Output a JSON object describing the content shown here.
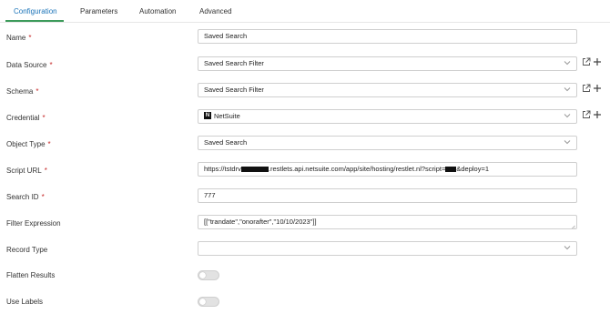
{
  "tabs": [
    {
      "label": "Configuration",
      "active": true
    },
    {
      "label": "Parameters",
      "active": false
    },
    {
      "label": "Automation",
      "active": false
    },
    {
      "label": "Advanced",
      "active": false
    }
  ],
  "required_marker": "*",
  "fields": {
    "name": {
      "label": "Name",
      "value": "Saved Search"
    },
    "data_source": {
      "label": "Data Source",
      "value": "Saved Search Filter"
    },
    "schema": {
      "label": "Schema",
      "value": "Saved Search Filter"
    },
    "credential": {
      "label": "Credential",
      "value": "NetSuite",
      "badge": "N"
    },
    "object_type": {
      "label": "Object Type",
      "value": "Saved Search"
    },
    "script_url": {
      "label": "Script URL",
      "prefix": "https://tstdrv",
      "middle": ".restlets.api.netsuite.com/app/site/hosting/restlet.nl?script=",
      "suffix": "&deploy=1"
    },
    "search_id": {
      "label": "Search ID",
      "value": "777"
    },
    "filter_expression": {
      "label": "Filter Expression",
      "value": "[[\"trandate\",\"onorafter\",\"10/10/2023\"]]"
    },
    "record_type": {
      "label": "Record Type",
      "value": ""
    },
    "flatten_results": {
      "label": "Flatten Results",
      "enabled": false
    },
    "use_labels": {
      "label": "Use Labels",
      "enabled": false
    }
  },
  "icons": {
    "dropdown": "chevron-down-icon",
    "edit": "edit-external-icon",
    "add": "plus-icon"
  },
  "colors": {
    "active_tab_text": "#1a73b8",
    "active_tab_underline": "#3d9b5b",
    "required": "#c62828"
  }
}
